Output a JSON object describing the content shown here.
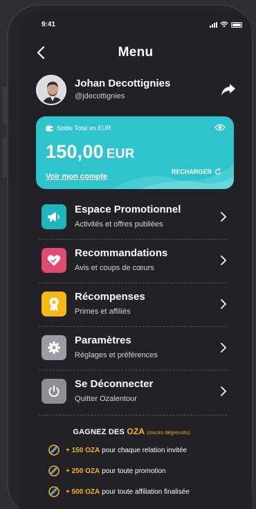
{
  "status": {
    "time": "9:41"
  },
  "header": {
    "title": "Menu"
  },
  "profile": {
    "name": "Johan Decottignies",
    "handle": "@jdecottignies"
  },
  "wallet": {
    "label": "Solde Total en EUR",
    "amount": "150,00",
    "currency": "EUR",
    "link": "Voir mon compte",
    "recharge": "RECHARGER",
    "color": "#2fc4cc"
  },
  "menu": {
    "items": [
      {
        "title": "Espace Promotionnel",
        "subtitle": "Activités et offres publiées",
        "icon": "megaphone-icon",
        "color": "#1fb6bd"
      },
      {
        "title": "Recommandations",
        "subtitle": "Avis et coups de cœurs",
        "icon": "heart-hand-icon",
        "color": "#e04a6e"
      },
      {
        "title": "Récompenses",
        "subtitle": "Primes et affiliés",
        "icon": "medal-icon",
        "color": "#f5b814"
      },
      {
        "title": "Paramètres",
        "subtitle": "Réglages et préférences",
        "icon": "gear-icon",
        "color": "#9c9ca4"
      },
      {
        "title": "Se Déconnecter",
        "subtitle": "Quitter Ozalentour",
        "icon": "power-icon",
        "color": "#8e8e95"
      }
    ]
  },
  "rewards": {
    "title_prefix": "GAGNEZ DES",
    "title_oza": "OZA",
    "title_note": "(stocks dégressifs)",
    "rows": [
      {
        "amount": "+ 150 OZA",
        "text": "pour chaque relation invitée"
      },
      {
        "amount": "+ 250 OZA",
        "text": "pour toute promotion"
      },
      {
        "amount": "+ 500 OZA",
        "text": "pour toute affiliation finalisée"
      }
    ],
    "accent": "#f5b814"
  }
}
